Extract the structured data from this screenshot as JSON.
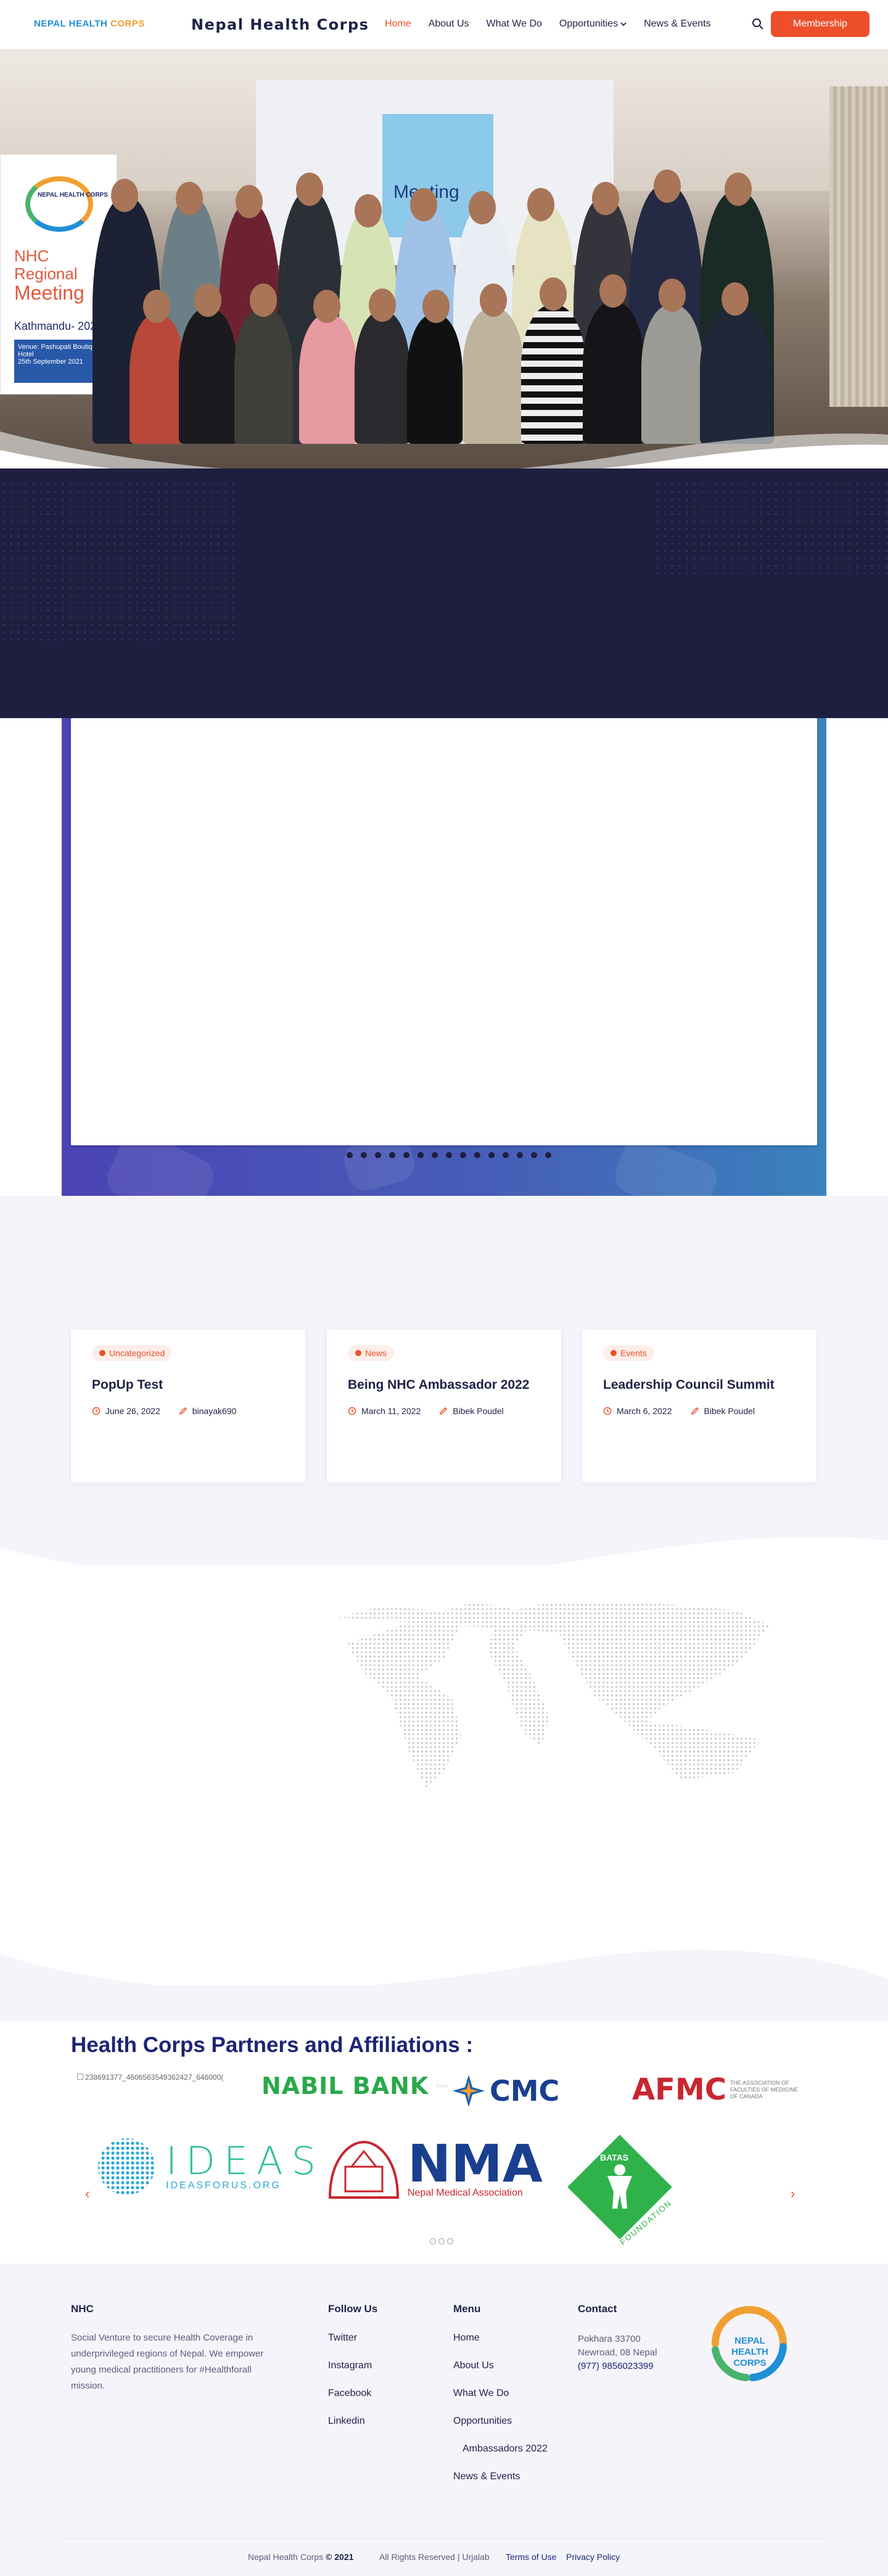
{
  "header": {
    "logo_text_a": "NEPAL",
    "logo_text_b": "HEALTH",
    "logo_text_c": "CORPS",
    "brand": "Nepal Health Corps",
    "nav": [
      "Home",
      "About Us",
      "What We Do",
      "Opportunities",
      "News & Events"
    ],
    "active_nav": "Home",
    "membership_label": "Membership"
  },
  "hero": {
    "banner_org": "NEPAL HEALTH CORPS",
    "banner_line1": "NHC",
    "banner_line2": "Regional",
    "banner_line3": "Meeting",
    "banner_city": "Kathmandu- 2021",
    "banner_venue": "Venue: Pashupati Boutique Hotel",
    "banner_date": "25th September 2021",
    "projector_text": "Meeting"
  },
  "news": {
    "cards": [
      {
        "tag": "Uncategorized",
        "title": "PopUp Test",
        "date": "June 26, 2022",
        "author": "binayak690"
      },
      {
        "tag": "News",
        "title": "Being NHC Ambassador 2022",
        "date": "March 11, 2022",
        "author": "Bibek Poudel"
      },
      {
        "tag": "Events",
        "title": "Leadership Council Summit",
        "date": "March 6, 2022",
        "author": "Bibek Poudel"
      }
    ]
  },
  "partners": {
    "heading": "Health Corps Partners and Affiliations :",
    "broken_image_alt": "238691377_4606563549362427_646000(",
    "logos": {
      "nabil": "NABIL BANK",
      "cmc": "CMC",
      "afmc": "AFMC",
      "afmc_sub": "THE ASSOCIATION OF FACULTIES OF MEDICINE OF CANADA",
      "ideas": "IDEAS",
      "ideas_sub": "IDEASFORUS.ORG",
      "nma": "NMA",
      "nma_sub": "Nepal Medical Association",
      "batas": "BATAS",
      "batas_sub": "FOUNDATION"
    },
    "prev_arrow": "‹",
    "next_arrow": "›"
  },
  "footer": {
    "nhc_heading": "NHC",
    "nhc_text": "Social Venture to secure Health Coverage in underprivileged regions of Nepal. We empower young medical practitioners for #Healthforall mission.",
    "follow_heading": "Follow Us",
    "follow_links": [
      "Twitter",
      "Instagram",
      "Facebook",
      "Linkedin"
    ],
    "menu_heading": "Menu",
    "menu_links": [
      "Home",
      "About Us",
      "What We Do",
      "Opportunities",
      "Ambassadors 2022",
      "News & Events"
    ],
    "contact_heading": "Contact",
    "contact_line1": "Pokhara 33700",
    "contact_line2": "Newroad, 08 Nepal",
    "contact_phone": "(977) 9856023399",
    "logo_text": "NEPAL HEALTH CORPS",
    "copyright_name": "Nepal Health Corps",
    "copyright_year": "© 2021",
    "rights": "All Rights Reserved | Urjalab",
    "terms": "Terms of Use",
    "privacy": "Privacy Policy"
  },
  "colors": {
    "accent": "#ee4f2b",
    "navy": "#1e2147",
    "dark_band": "#1e1f40",
    "lavender": "#f5f4fb"
  }
}
